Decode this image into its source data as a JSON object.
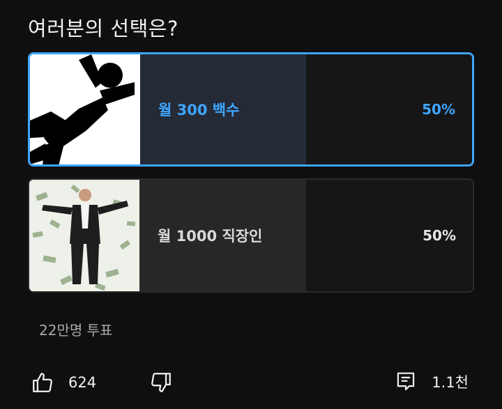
{
  "poll": {
    "question": "여러분의 선택은?",
    "options": [
      {
        "label": "월 300 백수",
        "percent": "50%",
        "fill": 0.5,
        "selected": true
      },
      {
        "label": "월 1000 직장인",
        "percent": "50%",
        "fill": 0.5,
        "selected": false
      }
    ],
    "votes": "22만명 투표"
  },
  "actions": {
    "like_count": "624",
    "comment_count": "1.1천"
  },
  "colors": {
    "accent": "#3ea6ff",
    "background": "#0f0f0f",
    "selected_fill": "#252a37",
    "unselected_fill": "#272727"
  },
  "icons": [
    "thumb-up-icon",
    "thumb-down-icon",
    "comment-icon"
  ]
}
